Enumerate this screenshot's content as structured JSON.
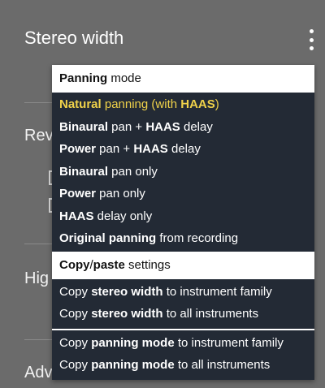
{
  "background": {
    "title": "Stereo width",
    "labels": [
      "Rev",
      "Hig",
      "Adv"
    ],
    "kebab_icon": "more-vert-icon"
  },
  "menu": {
    "panning_header": {
      "bold": "Panning",
      "rest": " mode"
    },
    "panning_items": [
      {
        "bold": "Natural",
        "rest": " panning (with ",
        "bold2": "HAAS",
        "rest2": ")",
        "selected": true
      },
      {
        "bold": "Binaural",
        "rest": " pan + ",
        "bold2": "HAAS",
        "rest2": " delay",
        "selected": false
      },
      {
        "bold": "Power",
        "rest": " pan + ",
        "bold2": "HAAS",
        "rest2": " delay",
        "selected": false
      },
      {
        "bold": "Binaural",
        "rest": " pan only",
        "bold2": "",
        "rest2": "",
        "selected": false
      },
      {
        "bold": "Power",
        "rest": " pan only",
        "bold2": "",
        "rest2": "",
        "selected": false
      },
      {
        "bold": "HAAS",
        "rest": " delay only",
        "bold2": "",
        "rest2": "",
        "selected": false
      },
      {
        "bold": "Original panning",
        "rest": " from recording",
        "bold2": "",
        "rest2": "",
        "selected": false
      }
    ],
    "copy_header": {
      "bold": "Copy",
      "mid": "/",
      "bold2": "paste",
      "rest": " settings"
    },
    "copy_items": [
      {
        "pre": "Copy ",
        "bold": "stereo width",
        "rest": " to instrument family"
      },
      {
        "pre": "Copy ",
        "bold": "stereo width",
        "rest": " to all instruments"
      },
      {
        "pre": "Copy ",
        "bold": "panning mode",
        "rest": " to instrument family"
      },
      {
        "pre": "Copy ",
        "bold": "panning mode",
        "rest": " to all instruments"
      }
    ]
  },
  "colors": {
    "background": "#6b6b6b",
    "menu_bg": "#232a35",
    "selected": "#f0d24a",
    "header_bg": "#ffffff"
  }
}
